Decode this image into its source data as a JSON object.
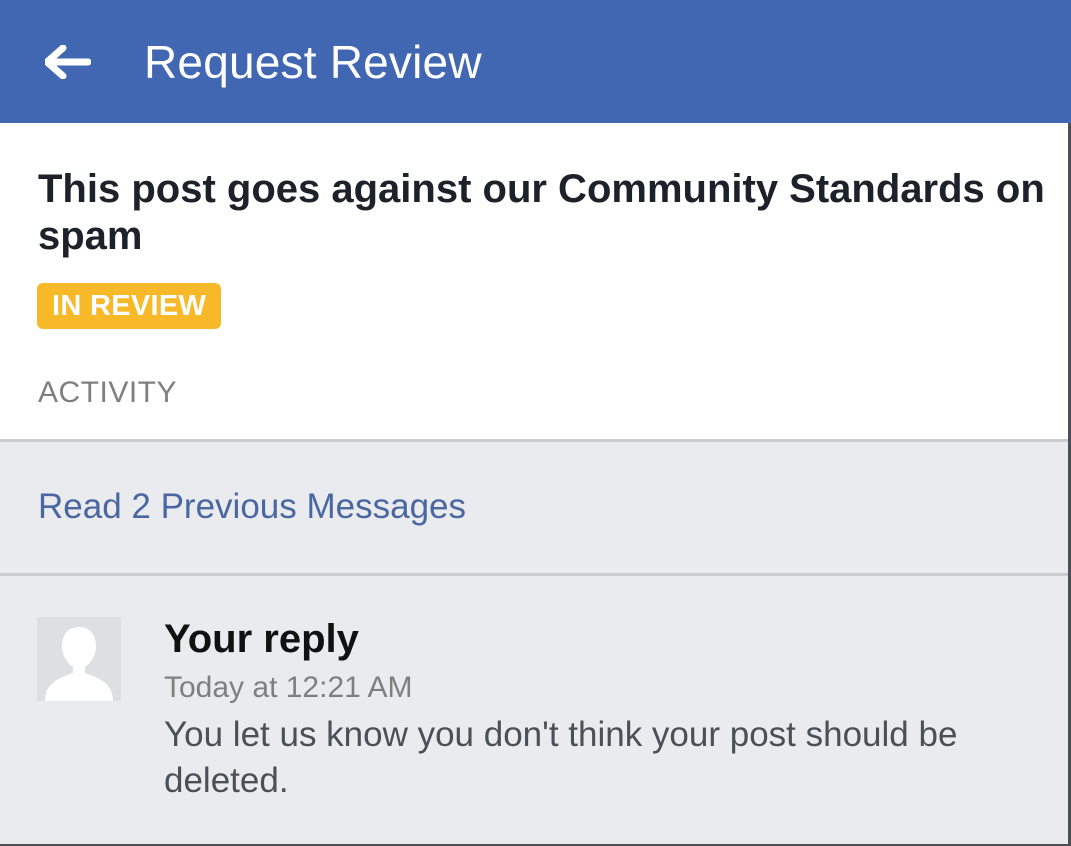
{
  "header": {
    "title": "Request Review",
    "back_icon": "arrow-left-icon"
  },
  "report": {
    "title": "This post goes against our Community Standards on spam",
    "status": "IN REVIEW",
    "status_color": "#f7b928",
    "section_label": "ACTIVITY"
  },
  "activity": {
    "previous_messages_label": "Read 2 Previous Messages",
    "messages": [
      {
        "author": "Your reply",
        "timestamp": "Today at 12:21 AM",
        "body": "You let us know you don't think your post should be deleted.",
        "avatar_icon": "default-avatar-icon"
      }
    ]
  },
  "colors": {
    "brand": "#4267b2",
    "link": "#4b67a1",
    "background": "#e9ebee"
  }
}
